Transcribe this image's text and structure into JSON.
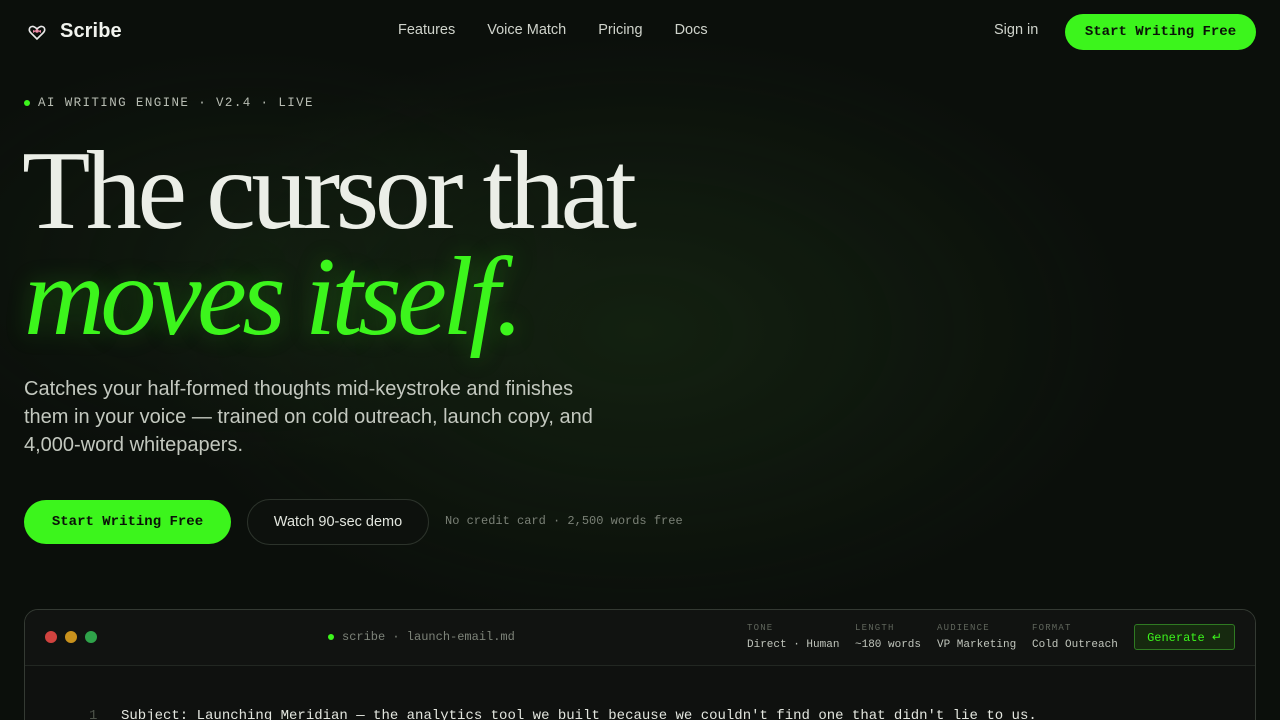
{
  "brand": {
    "name": "Scribe",
    "icon": "heart-bow-icon"
  },
  "nav": {
    "links": [
      "Features",
      "Voice Match",
      "Pricing",
      "Docs"
    ],
    "signin": "Sign in",
    "cta": "Start Writing Free"
  },
  "hero": {
    "eyebrow": "AI WRITING ENGINE · V2.4 · LIVE",
    "headline_line1": "The cursor that",
    "headline_line2": "moves itself.",
    "subtitle": "Catches your half-formed thoughts mid-keystroke and finishes them in your voice — trained on cold outreach, launch copy, and 4,000-word whitepapers.",
    "primary_cta": "Start Writing Free",
    "secondary_cta": "Watch 90-sec demo",
    "fine_print": "No credit card · 2,500 words free"
  },
  "editor": {
    "filename": "scribe · launch-email.md",
    "window_dots": [
      "#d1433f",
      "#c9921d",
      "#2fa34a"
    ],
    "meta": [
      {
        "key": "TONE",
        "value": "Direct · Human"
      },
      {
        "key": "LENGTH",
        "value": "~180 words"
      },
      {
        "key": "AUDIENCE",
        "value": "VP Marketing"
      },
      {
        "key": "FORMAT",
        "value": "Cold Outreach"
      }
    ],
    "generate_label": "Generate ↵",
    "lines": [
      {
        "number": "1",
        "text": "Subject: Launching Meridian — the analytics tool we built because we couldn't find one that didn't lie to us."
      }
    ]
  },
  "colors": {
    "accent": "#3cf51c",
    "background": "#0b0f0b"
  }
}
